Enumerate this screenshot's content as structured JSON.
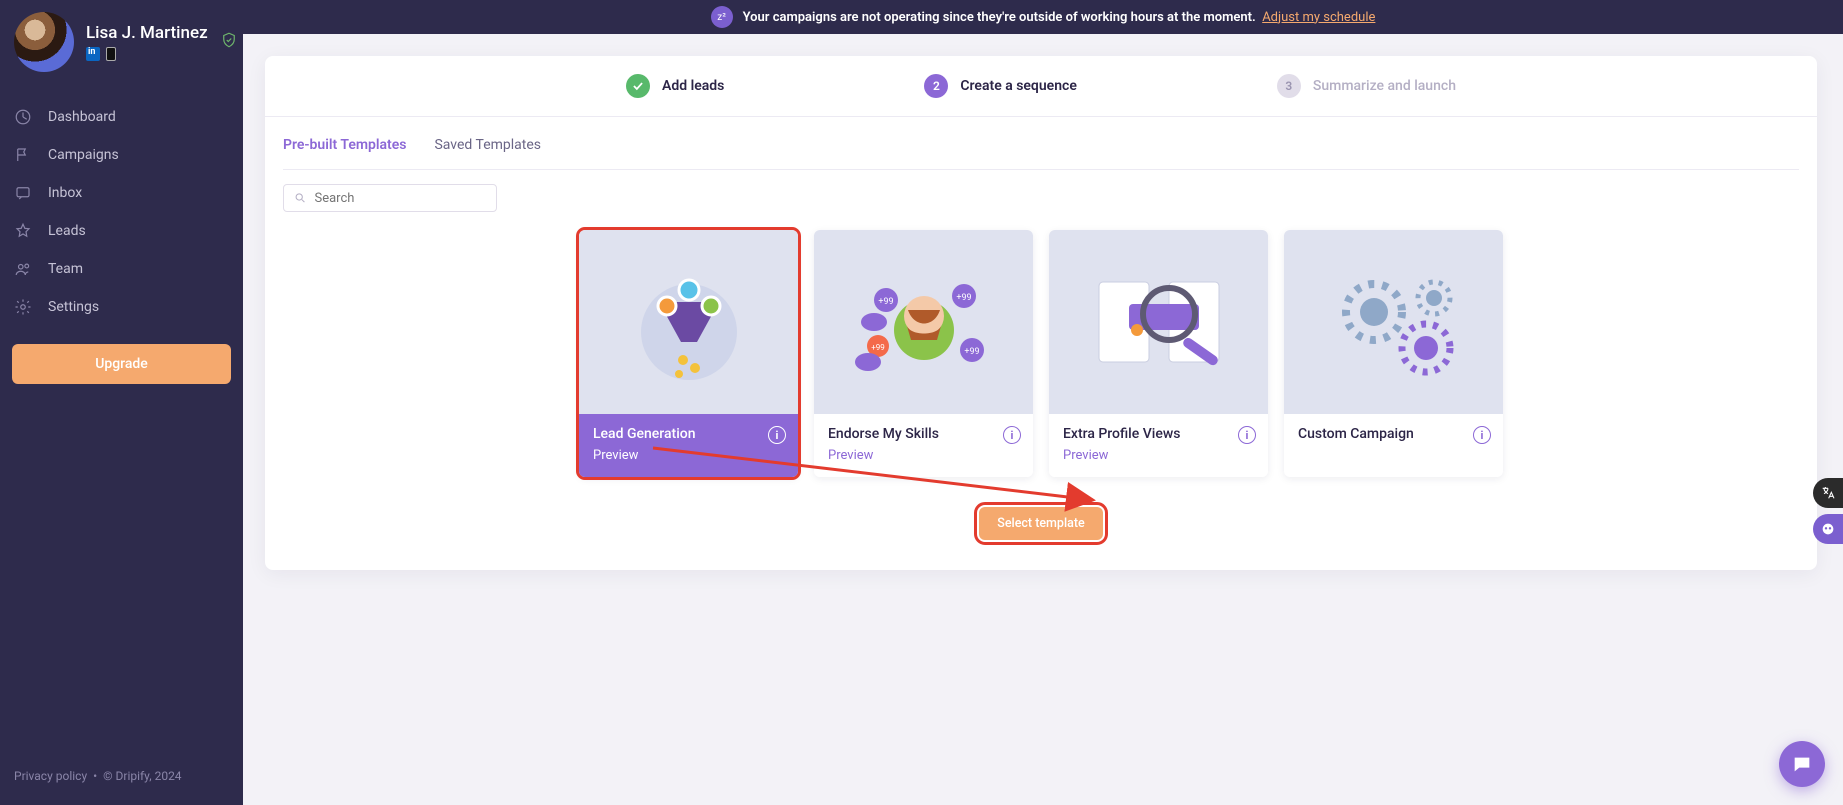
{
  "profile": {
    "name": "Lisa J. Martinez"
  },
  "nav": {
    "dashboard": "Dashboard",
    "campaigns": "Campaigns",
    "inbox": "Inbox",
    "leads": "Leads",
    "team": "Team",
    "settings": "Settings"
  },
  "upgrade_label": "Upgrade",
  "footer": {
    "privacy": "Privacy policy",
    "sep": "•",
    "copyright": "© Dripify, 2024"
  },
  "banner": {
    "message": "Your campaigns are not operating since they're outside of working hours at the moment.",
    "link": "Adjust my schedule"
  },
  "stepper": {
    "step1": {
      "label": "Add leads"
    },
    "step2": {
      "num": "2",
      "label": "Create a sequence"
    },
    "step3": {
      "num": "3",
      "label": "Summarize and launch"
    }
  },
  "tabs": {
    "prebuilt": "Pre-built Templates",
    "saved": "Saved Templates"
  },
  "search": {
    "placeholder": "Search"
  },
  "templates": [
    {
      "title": "Lead Generation",
      "preview": "Preview",
      "selected": true,
      "has_preview": true
    },
    {
      "title": "Endorse My Skills",
      "preview": "Preview",
      "selected": false,
      "has_preview": true
    },
    {
      "title": "Extra Profile Views",
      "preview": "Preview",
      "selected": false,
      "has_preview": true
    },
    {
      "title": "Custom Campaign",
      "preview": "",
      "selected": false,
      "has_preview": false
    }
  ],
  "select_label": "Select template",
  "icons": {
    "shield": "shield-icon",
    "dashboard": "dashboard-icon",
    "campaigns": "flag-icon",
    "inbox": "message-icon",
    "leads": "star-icon",
    "team": "users-icon",
    "settings": "gear-icon",
    "search": "search-icon",
    "info": "info-icon",
    "sleep": "sleep-icon",
    "translate": "translate-icon",
    "assistant": "assistant-icon",
    "chat": "chat-icon",
    "check": "check-icon"
  }
}
